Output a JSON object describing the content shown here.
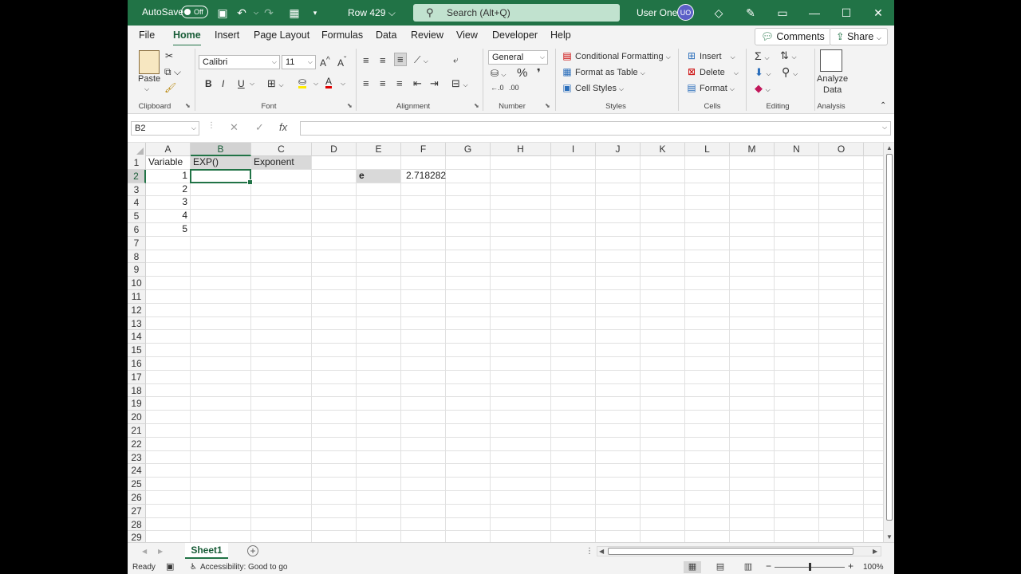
{
  "titlebar": {
    "autosave_label": "AutoSave",
    "autosave_state": "Off",
    "doc_title": "Row 429 ⌵",
    "search_placeholder": "Search (Alt+Q)",
    "user_name": "User One",
    "user_initials": "UO"
  },
  "menu": {
    "tabs": [
      "File",
      "Home",
      "Insert",
      "Page Layout",
      "Formulas",
      "Data",
      "Review",
      "View",
      "Developer",
      "Help"
    ],
    "active": "Home",
    "comments_label": "Comments",
    "share_label": "Share"
  },
  "ribbon": {
    "clipboard": {
      "paste_label": "Paste",
      "group_label": "Clipboard"
    },
    "font": {
      "font_name": "Calibri",
      "font_size": "11",
      "group_label": "Font",
      "bold": "B",
      "italic": "I",
      "underline": "U"
    },
    "alignment": {
      "group_label": "Alignment"
    },
    "number": {
      "format": "General",
      "group_label": "Number",
      "percent": "%"
    },
    "styles": {
      "conditional": "Conditional Formatting",
      "format_table": "Format as Table",
      "cell_styles": "Cell Styles",
      "group_label": "Styles"
    },
    "cells": {
      "insert": "Insert",
      "delete": "Delete",
      "format": "Format",
      "group_label": "Cells"
    },
    "editing": {
      "group_label": "Editing"
    },
    "analysis": {
      "analyze_line1": "Analyze",
      "analyze_line2": "Data",
      "group_label": "Analysis"
    }
  },
  "formula_bar": {
    "name_box": "B2",
    "formula": ""
  },
  "grid": {
    "columns": [
      "A",
      "B",
      "C",
      "D",
      "E",
      "F",
      "G",
      "H",
      "I",
      "J",
      "K",
      "L",
      "M",
      "N",
      "O"
    ],
    "selected_column": "B",
    "selected_row": "2",
    "rows": [
      "1",
      "2",
      "3",
      "4",
      "5",
      "6",
      "7",
      "8",
      "9",
      "10",
      "11",
      "12",
      "13",
      "14",
      "15",
      "16",
      "17",
      "18",
      "19",
      "20",
      "21",
      "22",
      "23",
      "24",
      "25",
      "26",
      "27",
      "28",
      "29"
    ],
    "cells": {
      "A1": "Variable",
      "B1": "EXP()",
      "C1": "Exponent",
      "A2": "1",
      "A3": "2",
      "A4": "3",
      "A5": "4",
      "A6": "5",
      "E2": "e",
      "F2": "2.718282"
    }
  },
  "sheets": {
    "active": "Sheet1"
  },
  "statusbar": {
    "ready": "Ready",
    "accessibility": "Accessibility: Good to go",
    "zoom": "100%"
  }
}
